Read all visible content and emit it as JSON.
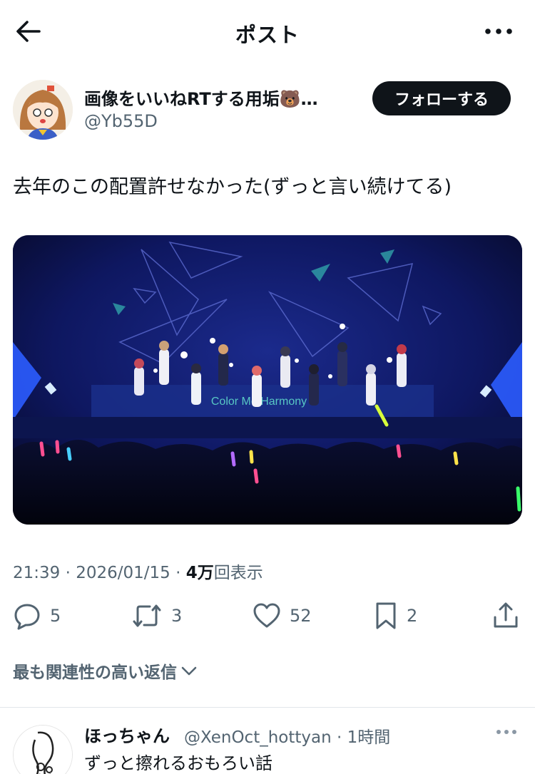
{
  "header": {
    "title": "ポスト"
  },
  "author": {
    "display_name": "画像をいいねRTする用垢🐻…",
    "handle": "@Yb55D",
    "follow_label": "フォローする"
  },
  "tweet": {
    "text": "去年のこの配置許せなかった(ずっと言い続けてる)"
  },
  "media": {
    "stage_banner_text": "Color Me Harmony"
  },
  "meta": {
    "time": "21:39",
    "date": "2026/01/15",
    "views_count": "4万",
    "views_label": "回表示"
  },
  "actions": {
    "replies": "5",
    "retweets": "3",
    "likes": "52",
    "bookmarks": "2"
  },
  "sort": {
    "label": "最も関連性の高い返信"
  },
  "reply": {
    "name": "ほっちゃん",
    "handle": "@XenOct_hottyan",
    "time": "1時間",
    "text": "ずっと擦れるおもろい話"
  },
  "colors": {
    "text_primary": "#0f1419",
    "text_secondary": "#536471",
    "button_bg": "#0f1419",
    "divider": "#e1e6ea"
  }
}
